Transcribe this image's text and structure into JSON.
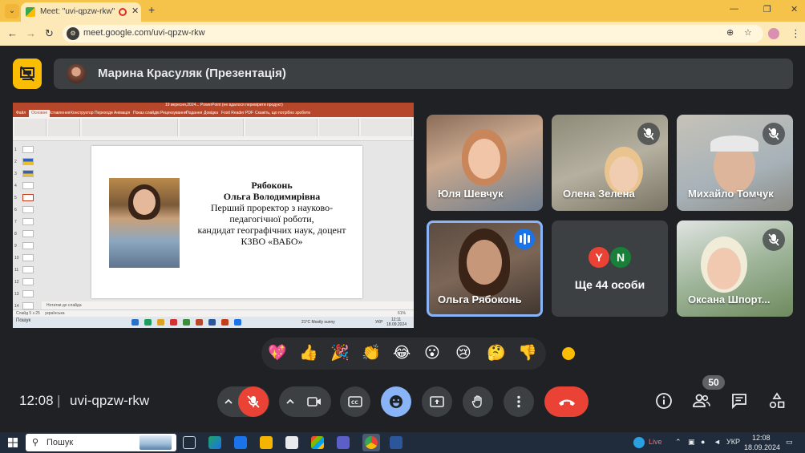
{
  "browser": {
    "tab_title": "Meet: \"uvi-qpzw-rkw\"",
    "url": "meet.google.com/uvi-qpzw-rkw",
    "tab_close": "✕",
    "new_tab": "+"
  },
  "meeting": {
    "presenter_label": "Марина Красуляк (Презентація)",
    "time": "12:08",
    "separator": "|",
    "code": "uvi-qpzw-rkw",
    "participant_count": "50"
  },
  "shared_screen": {
    "ppt_title": "19 вересня,2024... PowerPoint (не вдалося перевірити продукт)",
    "ribbon_tabs": [
      "Файл",
      "Основне",
      "Вставлення",
      "Конструктор",
      "Переходи",
      "Анімація",
      "Показ слайдів",
      "Рецензування",
      "Подання",
      "Довідка",
      "Foxit Reader PDF",
      "Скажіть, що потрібно зробити"
    ],
    "active_tab_index": 1,
    "slide": {
      "name_line1": "Рябоконь",
      "name_line2": "Ольга Володимирівна",
      "role_line1": "Перший проректор з науково-",
      "role_line2": "педагогічної роботи,",
      "role_line3": "кандидат географічних наук, доцент",
      "role_line4": "КЗВО «ВАБО»"
    },
    "thumbnail_numbers": [
      "1",
      "2",
      "3",
      "4",
      "5",
      "6",
      "7",
      "8",
      "9",
      "10",
      "11",
      "12",
      "13",
      "14"
    ],
    "notes_placeholder": "Нотатки до слайда",
    "status_left": "Слайд 5 з 25",
    "status_lang": "українська",
    "status_zoom": "61%",
    "inner_search": "Пошук",
    "inner_weather": "21°C Mostly sunny",
    "inner_lang": "УКР",
    "inner_time": "12:11",
    "inner_date": "18.09.2024"
  },
  "participants": [
    {
      "name": "Юля Шевчук",
      "muted": false
    },
    {
      "name": "Олена Зелена",
      "muted": true
    },
    {
      "name": "Михайло Томчук",
      "muted": true
    },
    {
      "name": "Ольга Рябоконь",
      "speaking": true
    },
    {
      "name": "Оксана Шпорт...",
      "muted": true
    }
  ],
  "more_tile": {
    "label": "Ще 44 особи",
    "avatars": [
      {
        "initial": "Y",
        "color": "#ea4335"
      },
      {
        "initial": "N",
        "color": "#188038"
      }
    ]
  },
  "reactions": [
    "💖",
    "👍",
    "🎉",
    "👏",
    "😂",
    "😮",
    "😢",
    "🤔",
    "👎"
  ],
  "taskbar": {
    "search_placeholder": "Пошук",
    "live": "Live",
    "lang": "УКР",
    "time": "12:08",
    "date": "18.09.2024"
  },
  "colors": {
    "meet_bg": "#202124",
    "tile_bg": "#3c4043",
    "end_call": "#ea4335",
    "active_blue": "#8ab4f8",
    "presentation_accent": "#fbbc04",
    "chrome_tab": "#f6c34a"
  }
}
